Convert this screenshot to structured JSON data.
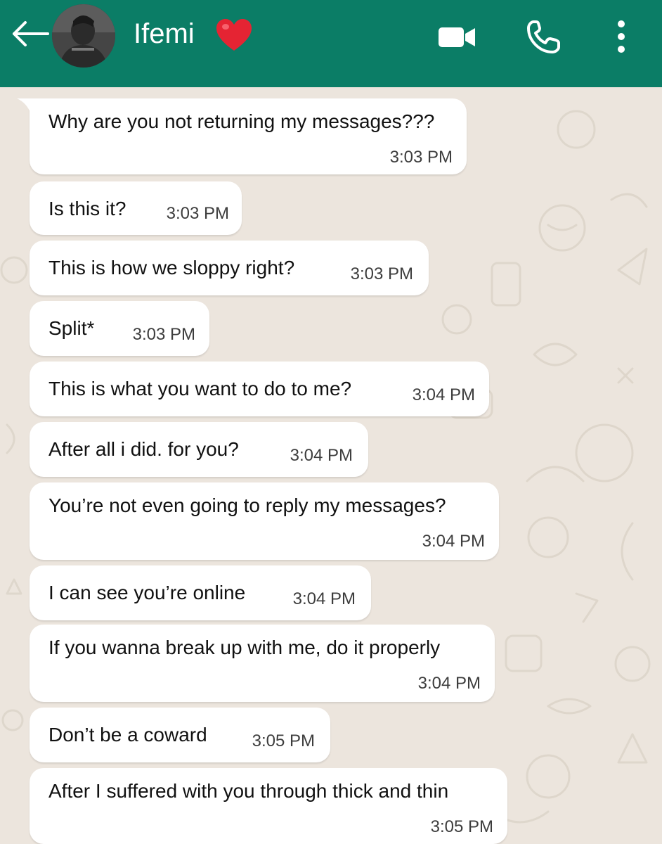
{
  "header": {
    "contact_name": "Ifemi",
    "background_color": "#0B7D66",
    "icons": [
      "back-arrow-icon",
      "avatar",
      "heart-icon",
      "video-call-icon",
      "phone-icon",
      "more-menu-icon"
    ]
  },
  "chat": {
    "background_color": "#ECE5DD",
    "bubble_color": "#FFFFFF",
    "messages": [
      {
        "text": "Why are you not returning my messages???",
        "time": "3:03 PM"
      },
      {
        "text": "Is this it?",
        "time": "3:03 PM"
      },
      {
        "text": "This is how we sloppy right?",
        "time": "3:03 PM"
      },
      {
        "text": "Split*",
        "time": "3:03 PM"
      },
      {
        "text": "This is what you want to do to me?",
        "time": "3:04 PM"
      },
      {
        "text": "After all i did. for you?",
        "time": "3:04 PM"
      },
      {
        "text": "You’re not even going to reply my messages?",
        "time": "3:04 PM"
      },
      {
        "text": "I can see you’re online",
        "time": "3:04 PM"
      },
      {
        "text": "If you wanna break up with me, do it properly",
        "time": "3:04 PM"
      },
      {
        "text": "Don’t be a coward",
        "time": "3:05 PM"
      },
      {
        "text": "After I suffered with you through thick and thin",
        "time": "3:05 PM"
      }
    ]
  }
}
